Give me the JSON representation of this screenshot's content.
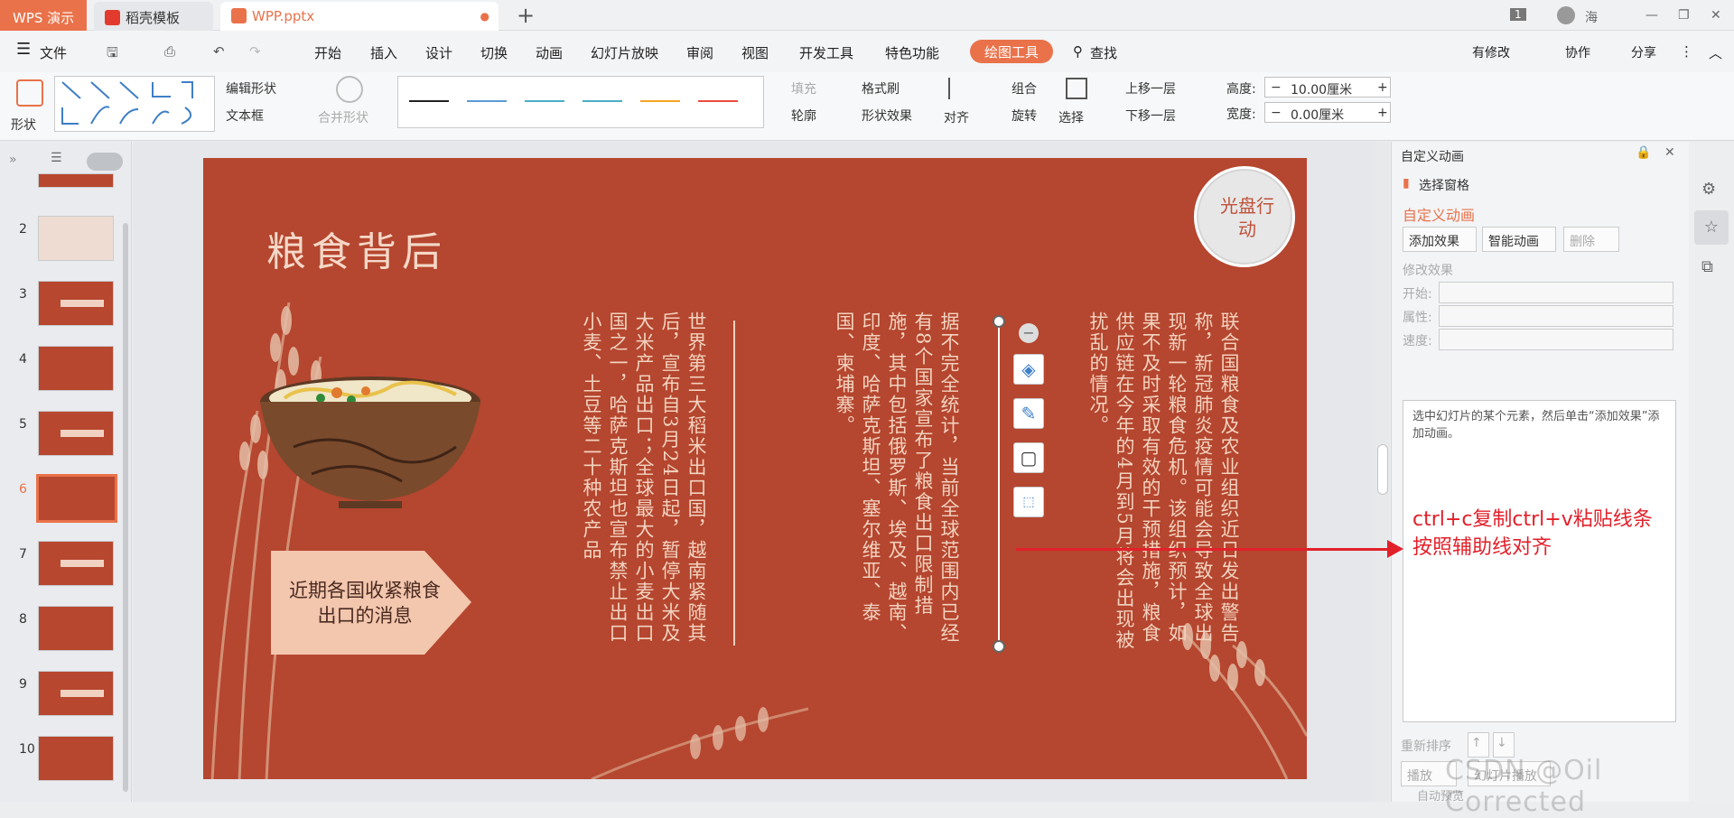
{
  "titlebar": {
    "app_tab": "WPS 演示",
    "tabs": [
      {
        "label": "稻壳模板",
        "icon": "daoke-icon"
      },
      {
        "label": "WPP.pptx",
        "icon": "ppt-icon"
      }
    ],
    "badge_count": "1",
    "user": "海"
  },
  "menu": {
    "file": "文件",
    "items": [
      "开始",
      "插入",
      "设计",
      "切换",
      "动画",
      "幻灯片放映",
      "审阅",
      "视图",
      "开发工具",
      "特色功能"
    ],
    "draw_tool": "绘图工具",
    "search": "查找",
    "right": [
      "有修改",
      "协作",
      "分享"
    ]
  },
  "ribbon": {
    "shape": "形状",
    "edit_shape": "编辑形状",
    "textbox": "文本框",
    "merge_shape": "合并形状",
    "fill": "填充",
    "format_painter": "格式刷",
    "outline": "轮廓",
    "shape_effect": "形状效果",
    "align": "对齐",
    "group": "组合",
    "rotate": "旋转",
    "select": "选择",
    "bring_forward": "上移一层",
    "send_backward": "下移一层",
    "height_label": "高度:",
    "height_value": "10.00厘米",
    "width_label": "宽度:",
    "width_value": "0.00厘米",
    "line_colors": [
      "#222222",
      "#5b9bd5",
      "#4bacc6",
      "#4bacc6",
      "#f5a623",
      "#e84c3d"
    ]
  },
  "slides": {
    "numbers": [
      "2",
      "3",
      "4",
      "5",
      "6",
      "7",
      "8",
      "9",
      "10"
    ],
    "selected": "6"
  },
  "slide": {
    "title": "粮食背后",
    "badge": "光盘行动",
    "col1": "联合国粮食及农业组织近日发出警告称，新冠肺炎疫情可能会导致全球出现新一轮粮食危机。该组织预计，如果不及时采取有效的干预措施，粮食供应链在今年的4月到5月将会出现被扰乱的情况。",
    "col2": "据不完全统计，当前全球范围内已经有8个国家宣布了粮食出口限制措施，其中包括俄罗斯、埃及、越南、印度、哈萨克斯坦、塞尔维亚、泰国、柬埔寨。",
    "col3": "世界第三大稻米出口国，越南紧随其后，宣布自3月24日起，暂停大米及大米产品出口；全球最大的小麦出口国之一，哈萨克斯坦也宣布禁止出口小麦、土豆等二十种农产品",
    "arrow_text": "近期各国收紧粮食出口的消息",
    "bg_color": "#b5462f"
  },
  "panel": {
    "header": "自定义动画",
    "select_pane": "选择窗格",
    "section_title": "自定义动画",
    "add_effect": "添加效果",
    "smart_anim": "智能动画",
    "delete": "删除",
    "modify": "修改效果",
    "start": "开始:",
    "property": "属性:",
    "speed": "速度:",
    "hint": "选中幻灯片的某个元素，然后单击“添加效果”添加动画。",
    "reorder": "重新排序",
    "play": "播放",
    "slideshow": "幻灯片播放",
    "auto_preview": "自动预览"
  },
  "annotation": {
    "text_line1": "ctrl+c复制ctrl+v粘贴线条",
    "text_line2": "按照辅助线对齐",
    "color": "#e2202a"
  },
  "watermark": "CSDN @Oil Corrected"
}
